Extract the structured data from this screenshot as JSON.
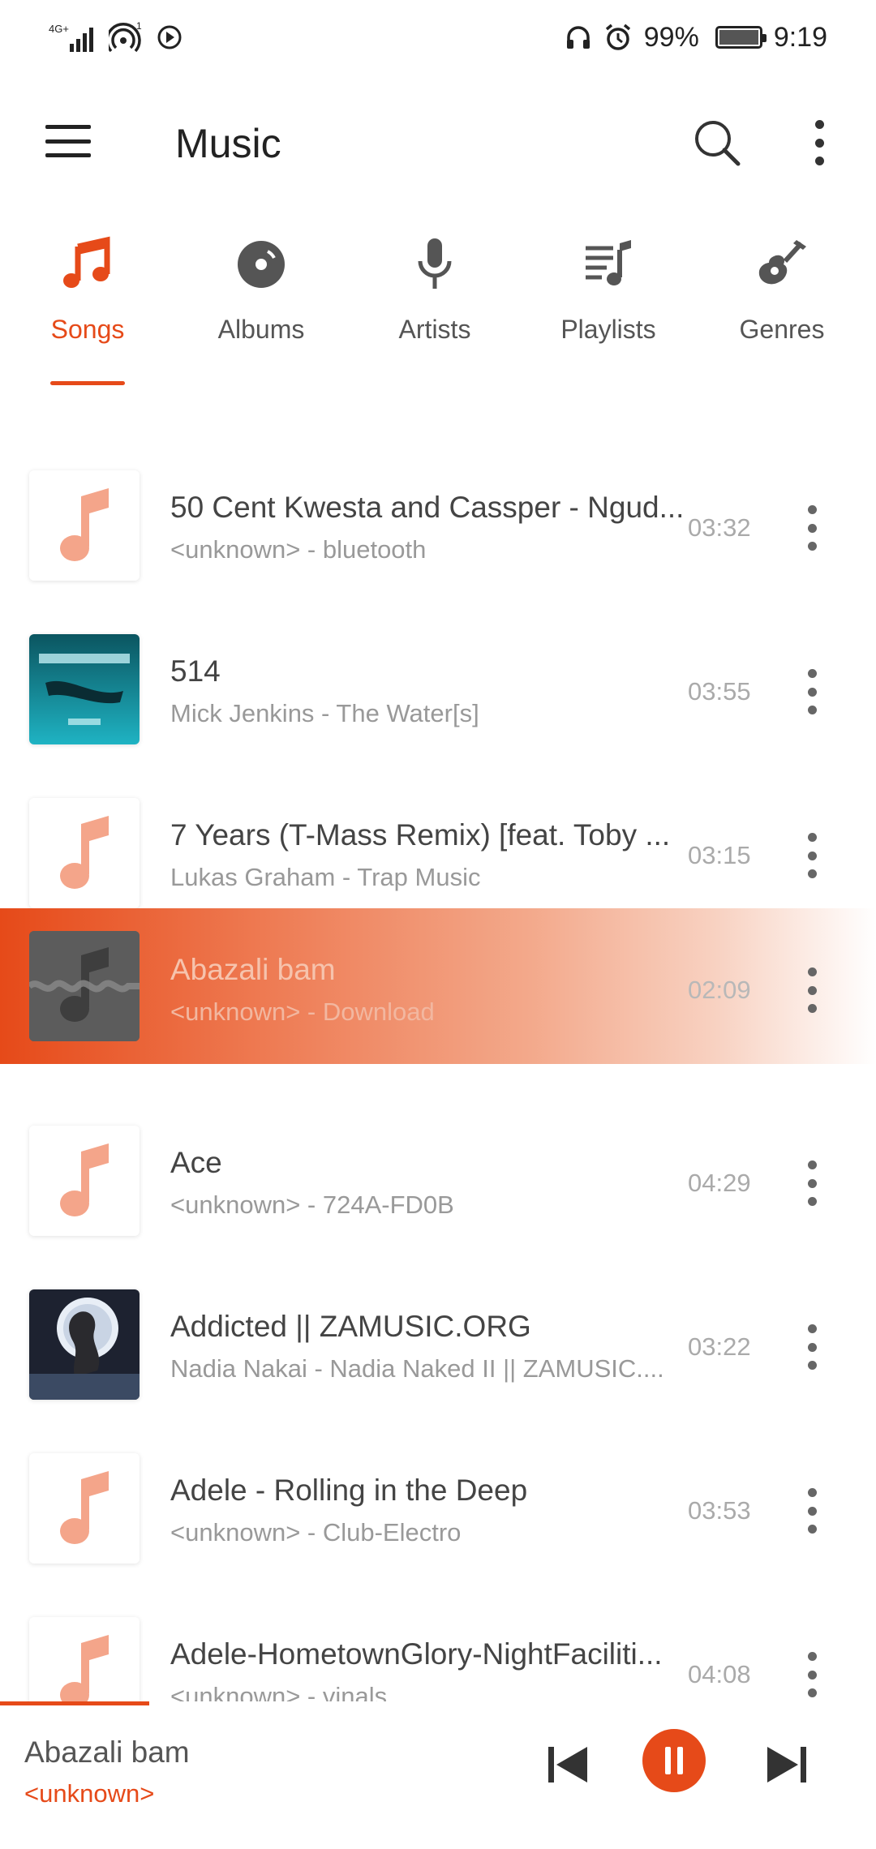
{
  "status_bar": {
    "signal": "4G+",
    "hotspot_badge": "1",
    "battery_percent": "99%",
    "time": "9:19"
  },
  "app_bar": {
    "title": "Music"
  },
  "tabs": [
    {
      "label": "Songs",
      "icon": "music-note-icon",
      "active": true
    },
    {
      "label": "Albums",
      "icon": "disc-icon",
      "active": false
    },
    {
      "label": "Artists",
      "icon": "microphone-icon",
      "active": false
    },
    {
      "label": "Playlists",
      "icon": "playlist-icon",
      "active": false
    },
    {
      "label": "Genres",
      "icon": "guitar-icon",
      "active": false
    }
  ],
  "songs": [
    {
      "title": "50 Cent Kwesta and Cassper - Ngud...",
      "subtitle": "<unknown> - bluetooth",
      "duration": "03:32",
      "art": "placeholder"
    },
    {
      "title": "514",
      "subtitle": "Mick Jenkins - The Water[s]",
      "duration": "03:55",
      "art": "album-water"
    },
    {
      "title": "7 Years (T-Mass Remix) [feat. Toby ...",
      "subtitle": "Lukas Graham - Trap Music",
      "duration": "03:15",
      "art": "placeholder"
    },
    {
      "title": "Abazali bam",
      "subtitle": "<unknown> - Download",
      "duration": "02:09",
      "art": "playing"
    },
    {
      "title": "Ace",
      "subtitle": "<unknown> - 724A-FD0B",
      "duration": "04:29",
      "art": "placeholder"
    },
    {
      "title": "Addicted || ZAMUSIC.ORG",
      "subtitle": "Nadia Nakai - Nadia Naked II || ZAMUSIC....",
      "duration": "03:22",
      "art": "album-nadia"
    },
    {
      "title": "Adele - Rolling in the Deep",
      "subtitle": "<unknown> - Club-Electro",
      "duration": "03:53",
      "art": "placeholder"
    },
    {
      "title": "Adele-HometownGlory-NightFaciliti...",
      "subtitle": "<unknown> - vinals",
      "duration": "04:08",
      "art": "placeholder"
    }
  ],
  "now_playing": {
    "title": "Abazali bam",
    "artist": "<unknown>",
    "progress": 0.17
  },
  "colors": {
    "accent": "#e64a19",
    "placeholder_note": "#f4a58a"
  }
}
